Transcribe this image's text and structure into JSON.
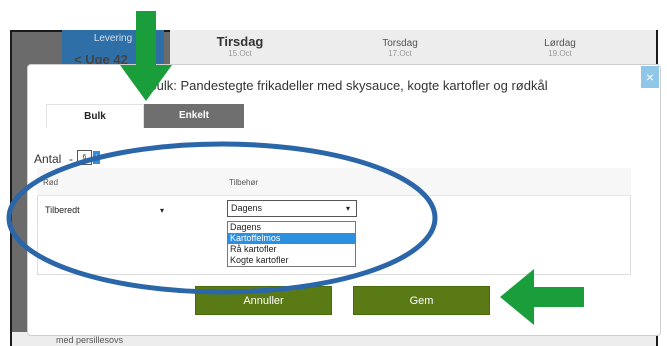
{
  "background": {
    "week_tab_label": "Levering",
    "week_label": "Uge 42",
    "week_prev_glyph": "<",
    "days": [
      {
        "name": "Tirsdag",
        "date": "15.Oct"
      },
      {
        "name": "Torsdag",
        "date": "17.Oct"
      },
      {
        "name": "Lørdag",
        "date": "19.Oct"
      }
    ],
    "bottom_text": "med persillesovs"
  },
  "modal": {
    "title": "Bulk: Pandestegte frikadeller med skysauce, kogte kartofler og rødkål",
    "close_glyph": "×",
    "tabs": [
      {
        "label": "Bulk",
        "active": true
      },
      {
        "label": "Enkelt",
        "active": false
      }
    ],
    "antal": {
      "label": "Antal",
      "minus": "-",
      "value": "6",
      "plus": "+"
    },
    "table": {
      "col_rod": "Rød",
      "col_tilbehor": "Tilbehør",
      "rod_value": "Tilberedt",
      "tilbehor_value": "Dagens",
      "caret": "▾",
      "dropdown_options": [
        "Dagens",
        "Kartoffelmos",
        "Rå kartofler",
        "Kogte kartofler"
      ],
      "dropdown_highlighted": "Kartoffelmos"
    },
    "buttons": {
      "cancel": "Annuller",
      "save": "Gem"
    }
  },
  "colors": {
    "annotation_arrow": "#1a9e3c",
    "annotation_ellipse": "#2a66a8",
    "button_green": "#5a7a16",
    "select_highlight": "#2d8fe0"
  },
  "icons": {
    "close": "close-icon",
    "dropdown_caret": "chevron-down-icon"
  }
}
